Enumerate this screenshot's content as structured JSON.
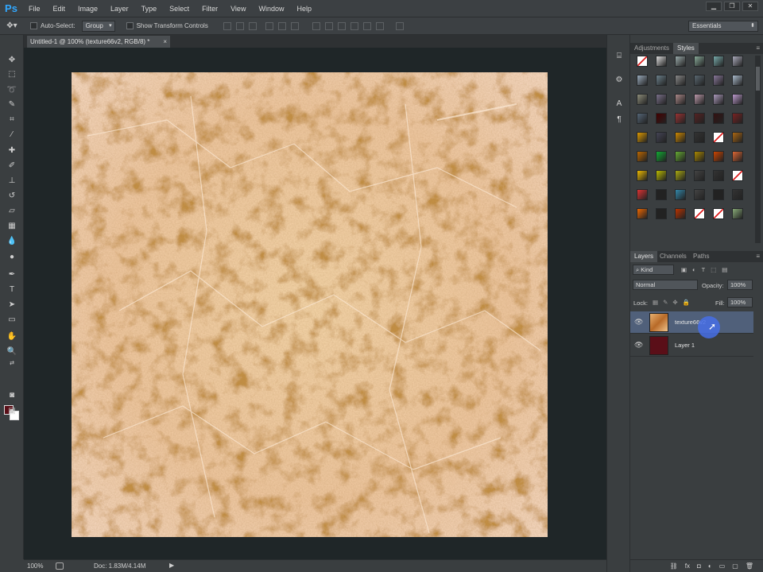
{
  "app": {
    "logo": "Ps"
  },
  "menu": [
    "File",
    "Edit",
    "Image",
    "Layer",
    "Type",
    "Select",
    "Filter",
    "View",
    "Window",
    "Help"
  ],
  "window_controls": {
    "minimize": "▁",
    "restore": "❐",
    "close": "✕"
  },
  "options": {
    "auto_select_label": "Auto-Select:",
    "auto_select_value": "Group",
    "show_transform_label": "Show Transform Controls",
    "workspace": "Essentials"
  },
  "document_tab": {
    "title": "Untitled-1 @ 100% (texture66v2, RGB/8) *",
    "close": "×"
  },
  "status": {
    "zoom": "100%",
    "doc_info": "Doc: 1.83M/4.14M",
    "arrow": "▶"
  },
  "colors": {
    "foreground": "#5a0f18",
    "background": "#ffffff",
    "accent": "#31a8ff"
  },
  "top_panel": {
    "tabs": [
      "Adjustments",
      "Styles"
    ],
    "active": "Styles"
  },
  "layers_panel": {
    "tabs": [
      "Layers",
      "Channels",
      "Paths"
    ],
    "active": "Layers",
    "filter_kind": "Kind",
    "blend_mode": "Normal",
    "opacity_label": "Opacity:",
    "opacity_value": "100%",
    "lock_label": "Lock:",
    "fill_label": "Fill:",
    "fill_value": "100%",
    "layers": [
      {
        "name": "texture66v2",
        "selected": true,
        "visible": true
      },
      {
        "name": "Layer 1",
        "selected": false,
        "visible": true
      }
    ]
  },
  "icons": {
    "eye": "👁",
    "panel_menu": "≡",
    "move_tool": "✥",
    "dropdown": "▾"
  }
}
